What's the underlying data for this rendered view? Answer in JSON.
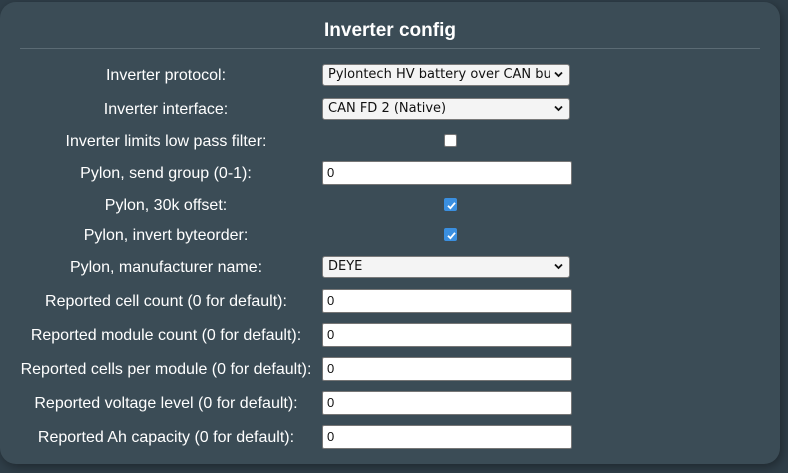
{
  "title": "Inverter config",
  "fields": {
    "protocol": {
      "label": "Inverter protocol:",
      "value": "Pylontech HV battery over CAN bus"
    },
    "interface": {
      "label": "Inverter interface:",
      "value": "CAN FD 2 (Native)"
    },
    "low_pass": {
      "label": "Inverter limits low pass filter:",
      "checked": false
    },
    "send_group": {
      "label": "Pylon, send group (0-1):",
      "value": "0"
    },
    "offset_30k": {
      "label": "Pylon, 30k offset:",
      "checked": true
    },
    "invert_byteorder": {
      "label": "Pylon, invert byteorder:",
      "checked": true
    },
    "manufacturer": {
      "label": "Pylon, manufacturer name:",
      "value": "DEYE"
    },
    "cell_count": {
      "label": "Reported cell count (0 for default):",
      "value": "0"
    },
    "module_count": {
      "label": "Reported module count (0 for default):",
      "value": "0"
    },
    "cells_per_module": {
      "label": "Reported cells per module (0 for default):",
      "value": "0"
    },
    "voltage_level": {
      "label": "Reported voltage level (0 for default):",
      "value": "0"
    },
    "ah_capacity": {
      "label": "Reported Ah capacity (0 for default):",
      "value": "0"
    }
  },
  "colors": {
    "background": "#2f3e48",
    "panel": "#3b4c56",
    "checkbox_checked": "#3a8fe0"
  }
}
